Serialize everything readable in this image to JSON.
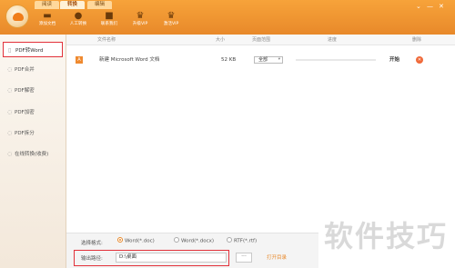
{
  "tabs": [
    {
      "label": "阅读"
    },
    {
      "label": "转换"
    },
    {
      "label": "编辑"
    }
  ],
  "toolbar": [
    {
      "label": "添加文档",
      "icon": "folder-icon"
    },
    {
      "label": "人工转换",
      "icon": "person-icon"
    },
    {
      "label": "联系我们",
      "icon": "chat-icon"
    },
    {
      "label": "升级VIP",
      "icon": "crown-icon"
    },
    {
      "label": "激活VIP",
      "icon": "crown-icon"
    }
  ],
  "sidebar": {
    "items": [
      {
        "label": "PDF转Word",
        "icon": "document-icon",
        "selected": true
      },
      {
        "label": "PDF合并",
        "icon": "merge-icon"
      },
      {
        "label": "PDF解密",
        "icon": "unlock-icon"
      },
      {
        "label": "PDF加密",
        "icon": "lock-icon"
      },
      {
        "label": "PDF拆分",
        "icon": "split-icon"
      },
      {
        "label": "在线转换(收费)",
        "icon": "globe-icon"
      }
    ]
  },
  "table": {
    "headers": {
      "name": "文件名称",
      "size": "大小",
      "pages": "页面范围",
      "progress": "进度",
      "delete": "删除"
    },
    "rows": [
      {
        "name": "新建 Microsoft Word 文档",
        "size": "52 KB",
        "pages": "全部",
        "progress": 0,
        "action": "开始"
      }
    ]
  },
  "output": {
    "format_label": "选择格式:",
    "formats": [
      {
        "label": "Word(*.doc)",
        "selected": true
      },
      {
        "label": "Word(*.docx)",
        "selected": false
      },
      {
        "label": "RTF(*.rtf)",
        "selected": false
      }
    ],
    "path_label": "输出路径:",
    "path_value": "D:\\桌面",
    "browse_label": "···",
    "open_dir_label": "打开目录"
  },
  "watermark": "软件技巧",
  "colors": {
    "accent": "#e8892a",
    "highlight": "#e2313a"
  }
}
